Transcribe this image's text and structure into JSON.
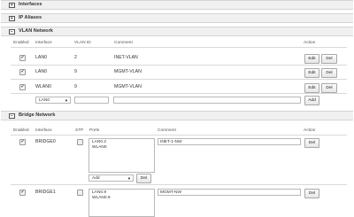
{
  "sections": {
    "interfaces": {
      "toggle": "+",
      "title": "Interfaces"
    },
    "ip_aliases": {
      "toggle": "+",
      "title": "IP Aliases"
    },
    "vlan": {
      "toggle": "−",
      "title": "VLAN Network"
    },
    "bridge": {
      "toggle": "−",
      "title": "Bridge Network"
    }
  },
  "vlan": {
    "headers": {
      "enabled": "Enabled",
      "interface": "Interface",
      "vlan_id": "VLAN ID",
      "comment": "Comment",
      "action": "Action"
    },
    "rows": [
      {
        "check": "✔",
        "interface": "LAN0",
        "vlan_id": "2",
        "comment": "INET-VLAN"
      },
      {
        "check": "✔",
        "interface": "LAN0",
        "vlan_id": "9",
        "comment": "MGMT-VLAN"
      },
      {
        "check": "✔",
        "interface": "WLAN0",
        "vlan_id": "9",
        "comment": "MGMT-VLAN"
      }
    ],
    "edit_label": "Edit",
    "del_label": "Del",
    "new_row": {
      "interface_select": "LAN0",
      "dropdown_glyph": "▼",
      "vlan_id_value": "",
      "comment_value": "",
      "add_label": "Add"
    }
  },
  "bridge": {
    "headers": {
      "enabled": "Enabled",
      "interface": "Interface",
      "stp": "STP",
      "ports": "Ports",
      "comment": "Comment",
      "action": "Action"
    },
    "rows": [
      {
        "check": "✔",
        "interface": "BRIDGE0",
        "ports": [
          "LAN0.2",
          "WLAN0"
        ],
        "comment": "INET-1-NW",
        "add_select": "Add",
        "dropdown_glyph": "▼",
        "del_label": "Del",
        "row_del_label": "Del"
      },
      {
        "check": "✔",
        "interface": "BRIDGE1",
        "ports": [
          "LAN0.9",
          "WLAN0.9"
        ],
        "comment": "MGMT-NW",
        "row_del_label": "Del"
      }
    ]
  }
}
